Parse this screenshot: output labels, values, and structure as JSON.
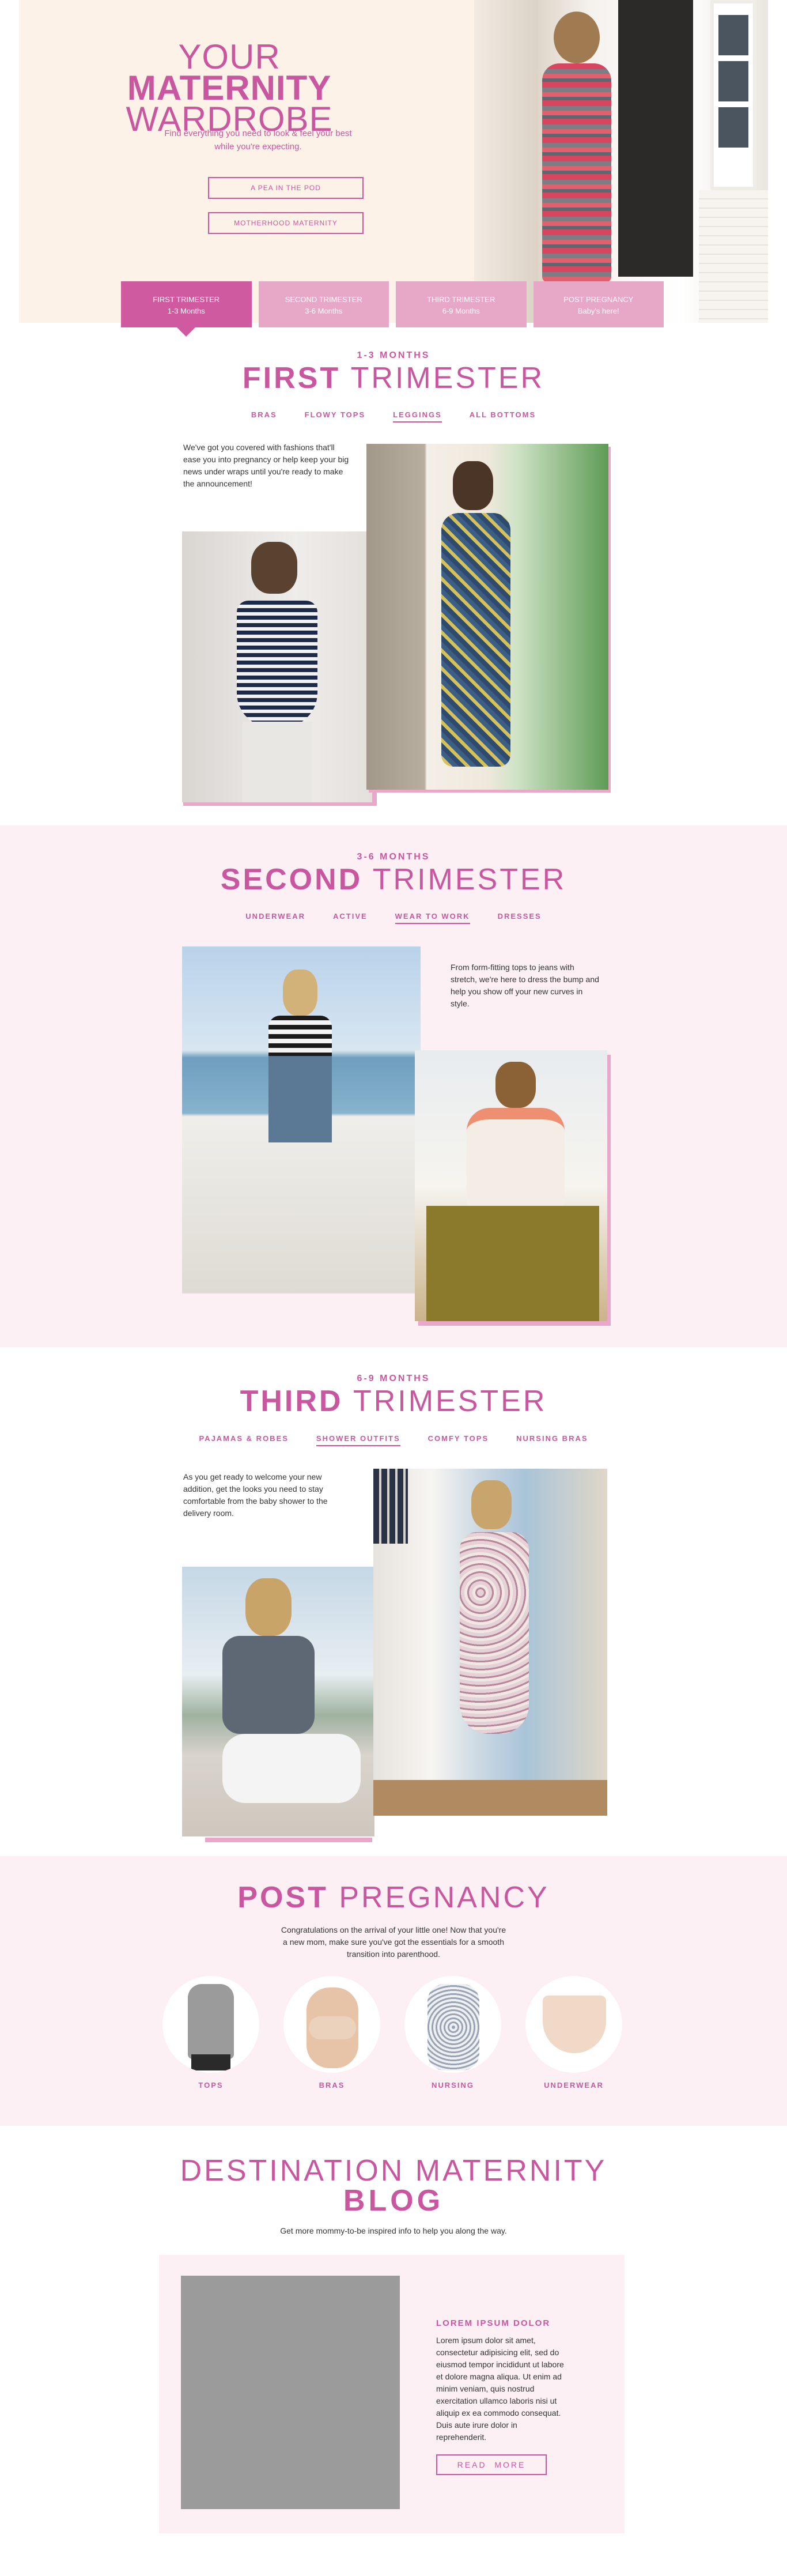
{
  "hero": {
    "title_light": "YOUR",
    "title_bold": "MATERNITY",
    "title_line2": "WARDROBE",
    "subtitle": "Find everything you need to look & feel your best while you're expecting.",
    "buttons": [
      "A PEA IN THE POD",
      "MOTHERHOOD MATERNITY"
    ]
  },
  "tabs": [
    {
      "label": "FIRST TRIMESTER",
      "sub": "1-3 Months",
      "active": true
    },
    {
      "label": "SECOND TRIMESTER",
      "sub": "3-6 Months",
      "active": false
    },
    {
      "label": "THIRD TRIMESTER",
      "sub": "6-9 Months",
      "active": false
    },
    {
      "label": "POST PREGNANCY",
      "sub": "Baby's here!",
      "active": false
    }
  ],
  "first": {
    "kicker": "1-3 MONTHS",
    "title_bold": "FIRST",
    "title_light": "TRIMESTER",
    "nav": [
      "BRAS",
      "FLOWY TOPS",
      "LEGGINGS",
      "ALL BOTTOMS"
    ],
    "nav_active": "LEGGINGS",
    "blurb": "We've got you covered with fashions that'll ease you into pregnancy or help keep your big news under wraps until you're ready to make the announcement!"
  },
  "second": {
    "kicker": "3-6 MONTHS",
    "title_bold": "SECOND",
    "title_light": "TRIMESTER",
    "nav": [
      "UNDERWEAR",
      "ACTIVE",
      "WEAR TO WORK",
      "DRESSES"
    ],
    "nav_active": "WEAR TO WORK",
    "blurb": "From form-fitting tops to jeans with stretch, we're here to dress the bump and help you show off your new curves in style."
  },
  "third": {
    "kicker": "6-9 MONTHS",
    "title_bold": "THIRD",
    "title_light": "TRIMESTER",
    "nav": [
      "PAJAMAS & ROBES",
      "SHOWER OUTFITS",
      "COMFY TOPS",
      "NURSING BRAS"
    ],
    "nav_active": "SHOWER OUTFITS",
    "blurb": "As you get ready to welcome your new addition, get the looks you need to stay comfortable from the baby shower to the delivery room."
  },
  "post": {
    "title_bold": "POST",
    "title_light": "PREGNANCY",
    "blurb": "Congratulations on the arrival of your little one! Now that you're a new mom, make sure you've got the essentials for a smooth transition into parenthood.",
    "categories": [
      "TOPS",
      "BRAS",
      "NURSING",
      "UNDERWEAR"
    ]
  },
  "blog": {
    "title": "DESTINATION MATERNITY",
    "title_bold": "BLOG",
    "subtitle": "Get more mommy-to-be inspired info to help you along the way.",
    "card_heading": "LOREM IPSUM DOLOR",
    "card_body": "Lorem ipsum dolor sit amet, consectetur adipisicing elit, sed do eiusmod tempor incididunt ut labore et dolore magna aliqua. Ut enim ad minim veniam, quis nostrud exercitation ullamco laboris nisi ut aliquip ex ea commodo consequat. Duis aute irure dolor in reprehenderit.",
    "button": "READ  MORE"
  },
  "colors": {
    "accent": "#c9579f",
    "tab": "#e7a8c7",
    "tab_active": "#d05aa0",
    "hero_bg": "#fdf2e8",
    "section_bg": "#fcf0f4"
  }
}
